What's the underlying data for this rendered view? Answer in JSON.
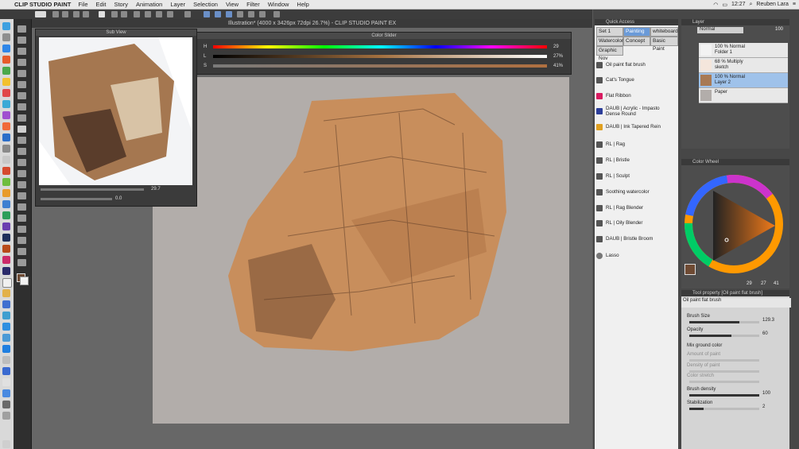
{
  "menubar": {
    "app": "CLIP STUDIO PAINT",
    "items": [
      "File",
      "Edit",
      "Story",
      "Animation",
      "Layer",
      "Selection",
      "View",
      "Filter",
      "Window",
      "Help"
    ],
    "time": "12:27",
    "user": "Reuben Lara"
  },
  "document": {
    "title": "Illustration* (4000 x 3426px 72dpi 26.7%) - CLIP STUDIO PAINT EX"
  },
  "subview": {
    "title": "Sub View",
    "zoom": "29.7",
    "angle": "0.0"
  },
  "color_slider": {
    "title": "Color Slider",
    "rows": [
      {
        "label": "H",
        "value": "29"
      },
      {
        "label": "L",
        "value": "27%"
      },
      {
        "label": "S",
        "value": "41%"
      }
    ]
  },
  "quick_access": {
    "title": "Quick Access",
    "sets": [
      "Set 1",
      "Painting",
      "whiteboard",
      "Watercolor",
      "Concept",
      "Basic Paint",
      "Graphic Nov"
    ],
    "brushes": [
      {
        "label": "Oil paint flat brush",
        "color": "#555555"
      },
      {
        "label": "Cat's Tongue",
        "color": "#555555"
      },
      {
        "label": "Flat Ribbon",
        "color": "#d81b60"
      },
      {
        "label": "DAUB | Acrylic - Impasto Dense Round",
        "color": "#2c3e9a"
      },
      {
        "label": "DAUB | Ink Tapered Rein",
        "color": "#e0a020"
      },
      {
        "label": "RL | Rag",
        "color": "#555555"
      },
      {
        "label": "RL | Bristle",
        "color": "#555555"
      },
      {
        "label": "RL | Sculpt",
        "color": "#555555"
      },
      {
        "label": "Soothing watercolor",
        "color": "#555555"
      },
      {
        "label": "RL | Rag Blender",
        "color": "#555555"
      },
      {
        "label": "RL | Oily Blender",
        "color": "#555555"
      },
      {
        "label": "DAUB | Bristle Broom",
        "color": "#555555"
      },
      {
        "label": "Lasso",
        "color": "#777777"
      }
    ]
  },
  "layers": {
    "title": "Layer",
    "blend": "Normal",
    "opacity": "100",
    "items": [
      {
        "line1": "100 % Normal",
        "line2": "Folder 1",
        "thumb": "#f2f2f2"
      },
      {
        "line1": "68 % Multiply",
        "line2": "sketch",
        "thumb": "#f4e6dc"
      },
      {
        "line1": "100 % Normal",
        "line2": "Layer 2",
        "thumb": "#a87a55",
        "selected": true
      },
      {
        "line1": "",
        "line2": "Paper",
        "thumb": "#b2adaa"
      }
    ]
  },
  "color_wheel": {
    "title": "Color Wheel",
    "values": [
      "29",
      "27",
      "41"
    ],
    "current_color": "#6e4a33"
  },
  "tool_property": {
    "title": "Tool property [Oil paint flat brush]",
    "brush_name": "Oil paint flat brush",
    "rows": [
      {
        "label": "Brush Size",
        "value": "129.3",
        "fill": 0.72
      },
      {
        "label": "Opacity",
        "value": "60",
        "fill": 0.6
      },
      {
        "label": "Mix ground color",
        "value": "",
        "fill": 0
      },
      {
        "label": "Amount of paint",
        "value": "",
        "fill": 0
      },
      {
        "label": "Density of paint",
        "value": "",
        "fill": 0
      },
      {
        "label": "Color stretch",
        "value": "",
        "fill": 0
      },
      {
        "label": "Brush density",
        "value": "100",
        "fill": 1.0
      },
      {
        "label": "Stabilization",
        "value": "2",
        "fill": 0.2
      }
    ]
  }
}
